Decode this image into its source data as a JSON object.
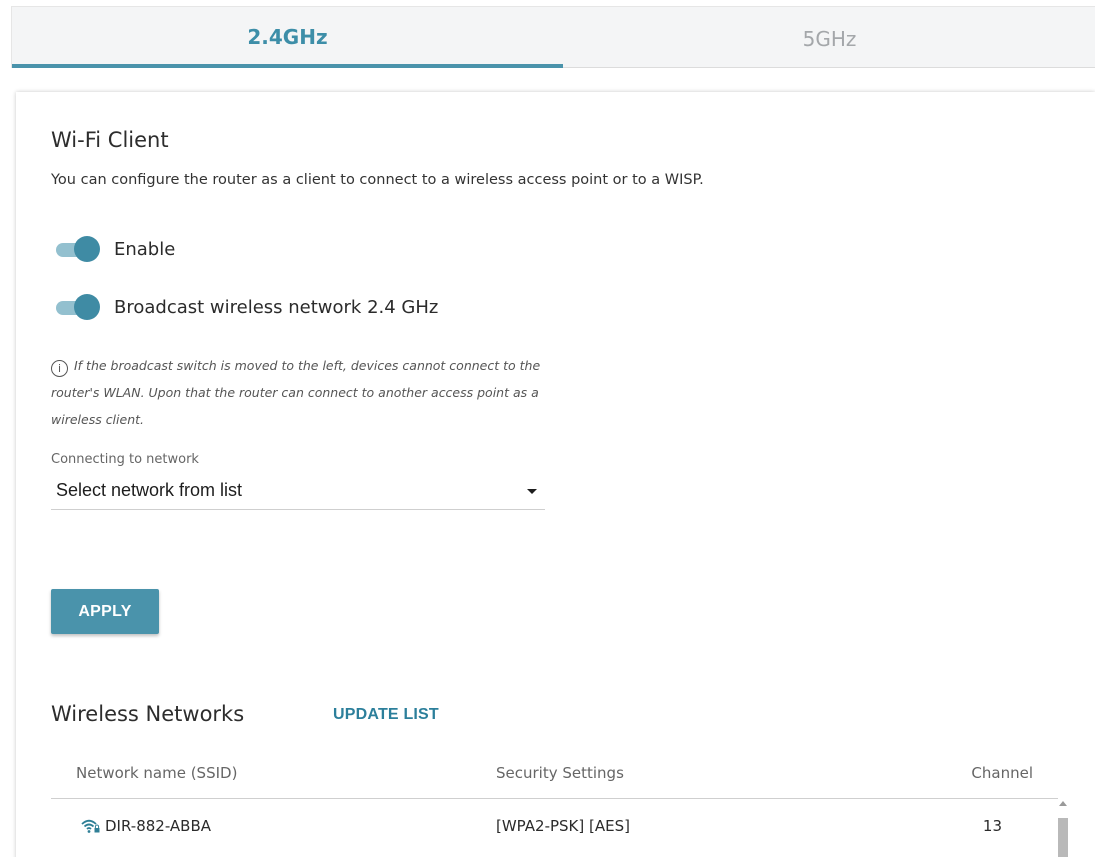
{
  "tabs": [
    {
      "label": "2.4GHz",
      "active": true
    },
    {
      "label": "5GHz",
      "active": false
    }
  ],
  "section": {
    "title": "Wi-Fi Client",
    "description": "You can configure the router as a client to connect to a wireless access point or to a WISP."
  },
  "toggles": [
    {
      "label": "Enable",
      "on": true
    },
    {
      "label": "Broadcast wireless network 2.4 GHz",
      "on": true
    }
  ],
  "info": {
    "icon": "info-icon",
    "text": "If the broadcast switch is moved to the left, devices cannot connect to the router's WLAN. Upon that the router can connect to another access point as a wireless client."
  },
  "network_select": {
    "label": "Connecting to network",
    "value": "Select network from list"
  },
  "apply_label": "APPLY",
  "wireless_networks": {
    "title": "Wireless Networks",
    "update_label": "UPDATE LIST",
    "columns": [
      "Network name (SSID)",
      "Security Settings",
      "Channel"
    ],
    "rows": [
      {
        "ssid": "DIR-882-ABBA",
        "security": "[WPA2-PSK] [AES]",
        "channel": "13",
        "icon": "wifi-lock-icon"
      }
    ]
  },
  "colors": {
    "accent": "#4a93ab",
    "link": "#2c7f9b",
    "inactive_tab": "#a4a7aa"
  }
}
